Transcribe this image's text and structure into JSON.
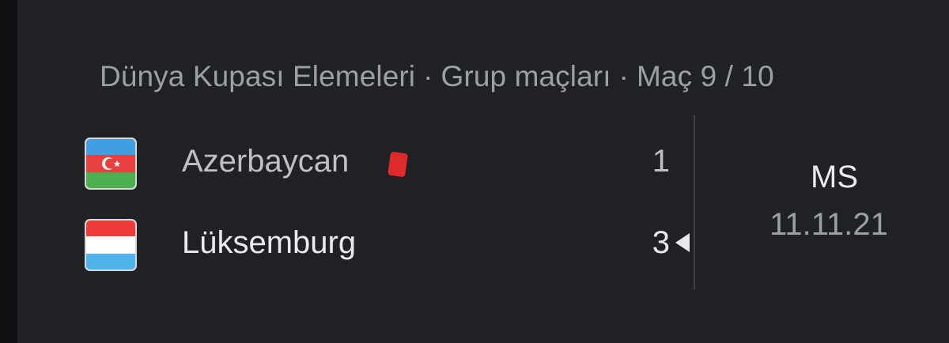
{
  "match": {
    "competition": "Dünya Kupası Elemeleri",
    "stage": "Grup maçları",
    "matchday": "Maç 9 / 10",
    "separator": "·",
    "status": "MS",
    "date": "11.11.21"
  },
  "home": {
    "name": "Azerbaycan",
    "score": "1",
    "flag_icon": "azerbaijan-flag-icon",
    "red_cards": 1
  },
  "away": {
    "name": "Lüksemburg",
    "score": "3",
    "flag_icon": "luxembourg-flag-icon",
    "winner": true
  },
  "colors": {
    "background": "#202124",
    "primary_text": "#e8eaed",
    "secondary_text": "#9aa0a6",
    "red_card": "#e02a2a"
  }
}
